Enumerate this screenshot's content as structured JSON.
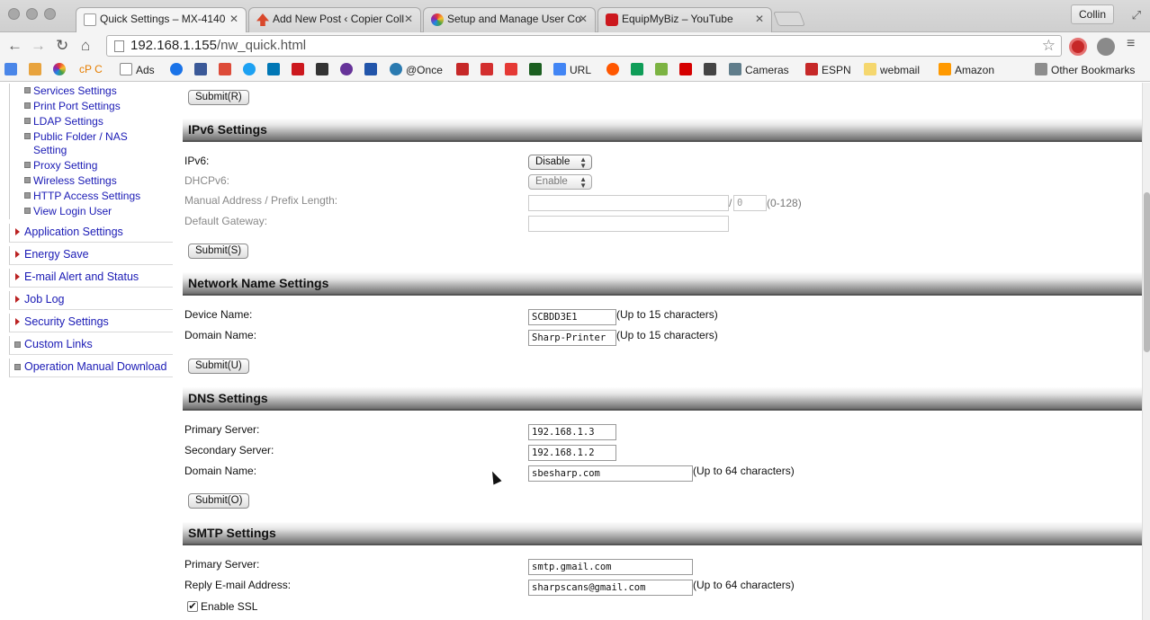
{
  "browser": {
    "tabs": [
      {
        "title": "Quick Settings – MX-4140",
        "fav_color": "#e8e8e8",
        "active": true
      },
      {
        "title": "Add New Post ‹ Copier Coll",
        "fav_color": "#d9482b",
        "active": false
      },
      {
        "title": "Setup and Manage User Co",
        "fav_color": "#4caf50",
        "active": false
      },
      {
        "title": "EquipMyBiz – YouTube",
        "fav_color": "#cc181e",
        "active": false
      }
    ],
    "user_button": "Collin",
    "url_host": "192.168.1.155",
    "url_path": "/nw_quick.html",
    "bookmarks": [
      {
        "label": "",
        "color": "#4a86e8"
      },
      {
        "label": "",
        "color": "#e8a33d"
      },
      {
        "label": "",
        "color": "#9c27b0"
      },
      {
        "label": "cP C",
        "color": "#ff9800"
      },
      {
        "label": "Ads",
        "color": "#3c78d8"
      },
      {
        "label": "",
        "color": "#1a73e8"
      },
      {
        "label": "",
        "color": "#3b5998"
      },
      {
        "label": "",
        "color": "#dd4b39"
      },
      {
        "label": "",
        "color": "#1da1f2"
      },
      {
        "label": "",
        "color": "#0077b5"
      },
      {
        "label": "",
        "color": "#cc181e"
      },
      {
        "label": "",
        "color": "#333333"
      },
      {
        "label": "",
        "color": "#663399"
      },
      {
        "label": "",
        "color": "#2255aa"
      },
      {
        "label": "@Once",
        "color": "#2a7ab0"
      },
      {
        "label": "",
        "color": "#c62828"
      },
      {
        "label": "",
        "color": "#d32f2f"
      },
      {
        "label": "",
        "color": "#e53935"
      },
      {
        "label": "",
        "color": "#1b5e20"
      },
      {
        "label": "URL",
        "color": "#4285f4"
      },
      {
        "label": "",
        "color": "#ff5700"
      },
      {
        "label": "",
        "color": "#0f9d58"
      },
      {
        "label": "",
        "color": "#7cb342"
      },
      {
        "label": "",
        "color": "#d50000"
      },
      {
        "label": "",
        "color": "#444444"
      },
      {
        "label": "Cameras",
        "color": "#607d8b"
      },
      {
        "label": "ESPN",
        "color": "#c62828"
      },
      {
        "label": "webmail",
        "color": "#f5d76e"
      },
      {
        "label": "Amazon",
        "color": "#ff9900"
      },
      {
        "label": "Other Bookmarks",
        "color": "#8d8d8d"
      }
    ]
  },
  "sidebar": {
    "sub_items": [
      "Services Settings",
      "Print Port Settings",
      "LDAP Settings",
      "Public Folder / NAS Setting",
      "Proxy Setting",
      "Wireless Settings",
      "HTTP Access Settings",
      "View Login User"
    ],
    "top_items": [
      {
        "label": "Application Settings",
        "marker": "triangle"
      },
      {
        "label": "Energy Save",
        "marker": "triangle"
      },
      {
        "label": "E-mail Alert and Status",
        "marker": "triangle"
      },
      {
        "label": "Job Log",
        "marker": "triangle"
      },
      {
        "label": "Security Settings",
        "marker": "triangle"
      },
      {
        "label": "Custom Links",
        "marker": "box"
      },
      {
        "label": "Operation Manual Download",
        "marker": "box"
      }
    ]
  },
  "main": {
    "submit_r": "Submit(R)",
    "ipv6": {
      "title": "IPv6 Settings",
      "ipv6_label": "IPv6:",
      "ipv6_value": "Disable",
      "dhcpv6_label": "DHCPv6:",
      "dhcpv6_value": "Enable",
      "manual_label": "Manual Address / Prefix Length:",
      "manual_value": "",
      "prefix_sep": "/",
      "prefix_value": "0",
      "prefix_range": "(0-128)",
      "gateway_label": "Default Gateway:",
      "gateway_value": "",
      "submit": "Submit(S)"
    },
    "network_name": {
      "title": "Network Name Settings",
      "device_label": "Device Name:",
      "device_value": "SCBDD3E1",
      "device_note": "(Up to 15 characters)",
      "domain_label": "Domain Name:",
      "domain_value": "Sharp-Printer",
      "domain_note": "(Up to 15 characters)",
      "submit": "Submit(U)"
    },
    "dns": {
      "title": "DNS Settings",
      "primary_label": "Primary Server:",
      "primary_value": "192.168.1.3",
      "secondary_label": "Secondary Server:",
      "secondary_value": "192.168.1.2",
      "domain_label": "Domain Name:",
      "domain_value": "sbesharp.com",
      "domain_note": "(Up to 64 characters)",
      "submit": "Submit(O)"
    },
    "smtp": {
      "title": "SMTP Settings",
      "primary_label": "Primary Server:",
      "primary_value": "smtp.gmail.com",
      "reply_label": "Reply E-mail Address:",
      "reply_value": "sharpscans@gmail.com",
      "reply_note": "(Up to 64 characters)",
      "ssl_label": "Enable SSL",
      "ssl_checked": "✔"
    }
  }
}
